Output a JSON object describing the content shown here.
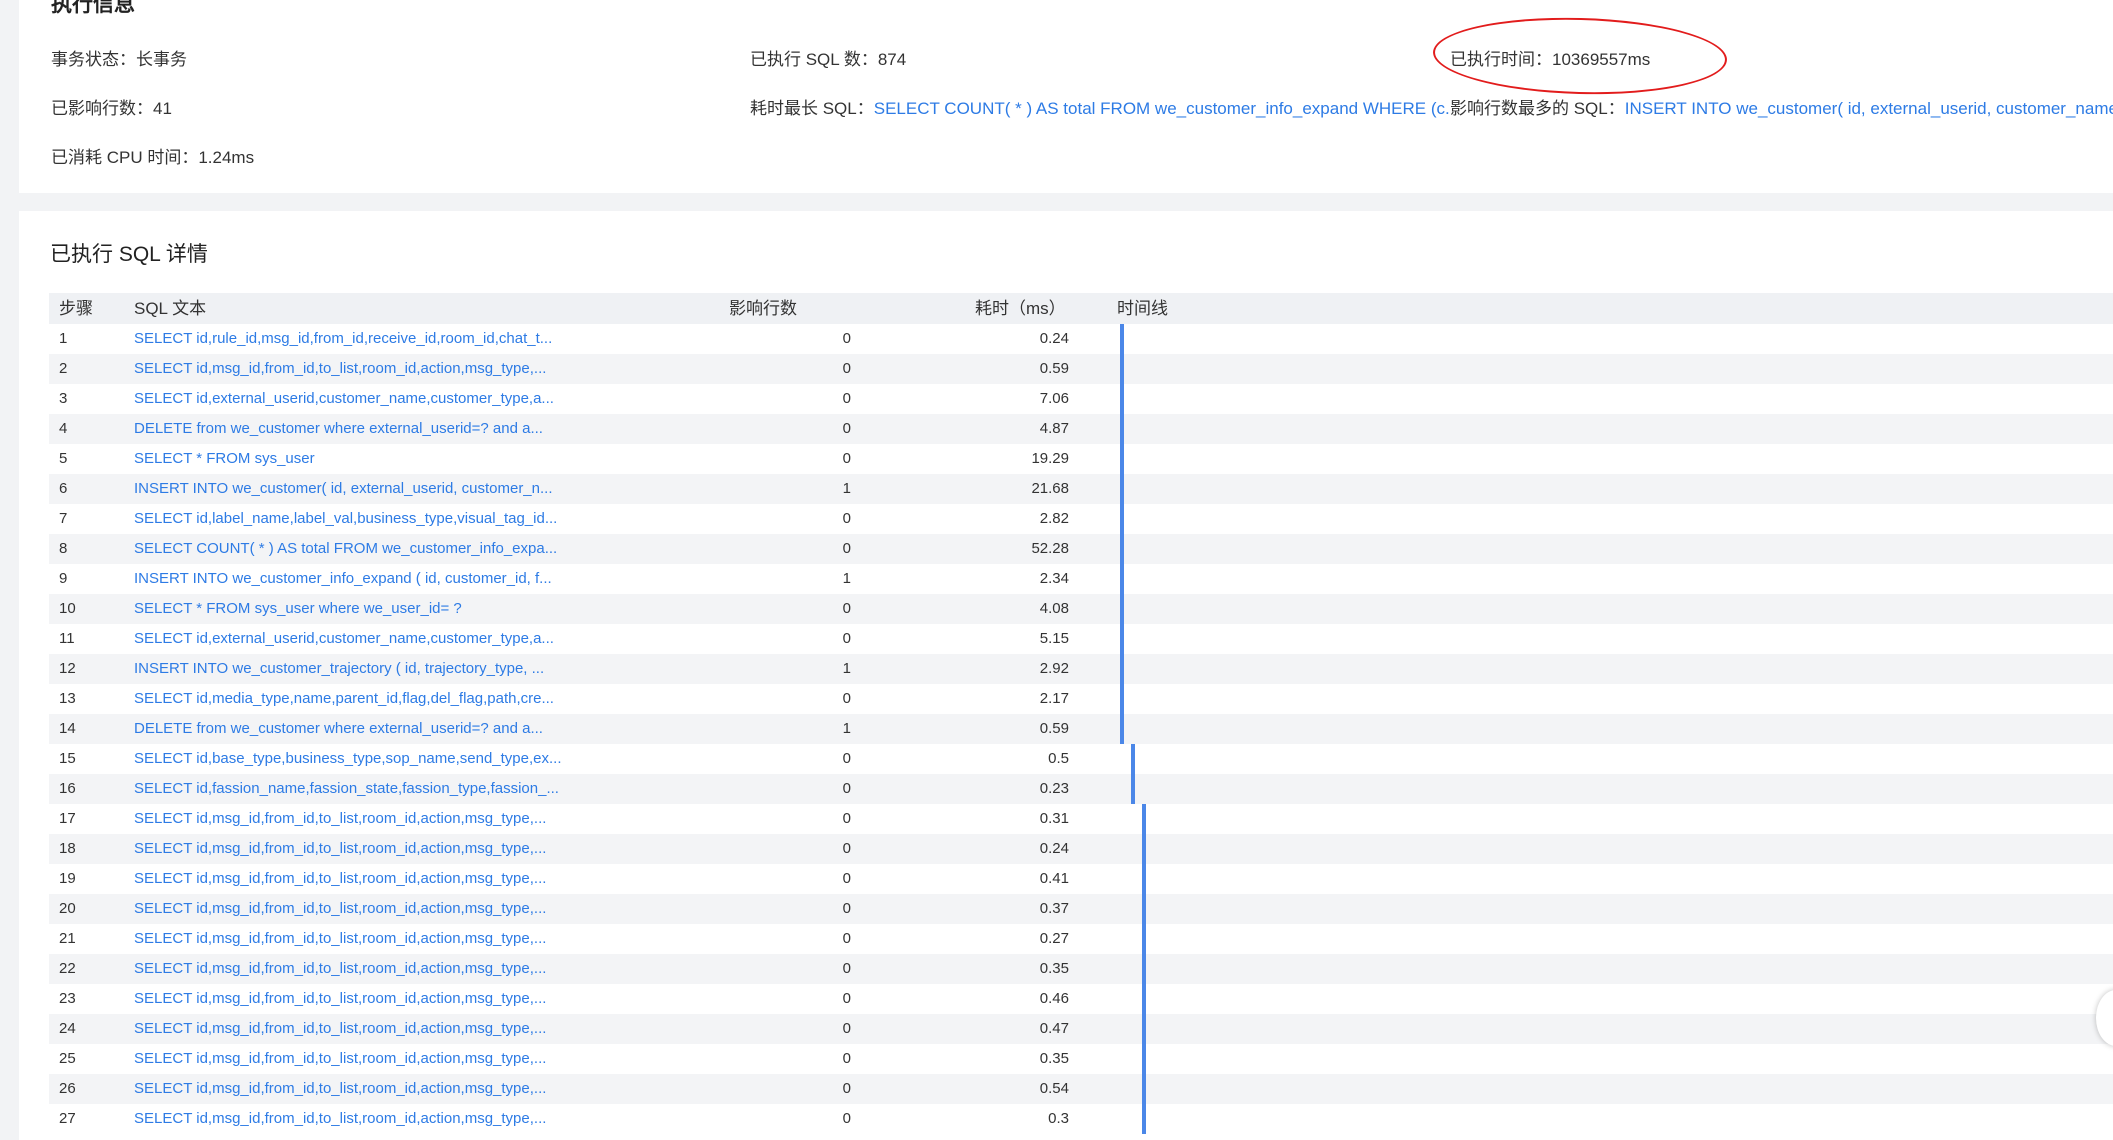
{
  "info": {
    "title": "执行信息",
    "transaction_status_label": "事务状态：",
    "transaction_status_value": "长事务",
    "executed_sql_count_label": "已执行 SQL 数：",
    "executed_sql_count_value": "874",
    "executed_time_label": "已执行时间：",
    "executed_time_value": "10369557ms",
    "affected_rows_label": "已影响行数：",
    "affected_rows_value": "41",
    "longest_sql_label": "耗时最长 SQL：",
    "longest_sql_value": "SELECT COUNT( * ) AS total FROM we_customer_info_expand WHERE (c...",
    "most_rows_sql_label": "影响行数最多的 SQL：",
    "most_rows_sql_value": "INSERT INTO we_customer( id, external_userid, customer_name,",
    "cpu_time_label": "已消耗 CPU 时间：",
    "cpu_time_value": "1.24ms"
  },
  "detail": {
    "title": "已执行 SQL 详情",
    "columns": [
      "步骤",
      "SQL 文本",
      "影响行数",
      "耗时（ms）",
      "时间线"
    ],
    "rows": [
      {
        "step": "1",
        "sql": "SELECT id,rule_id,msg_id,from_id,receive_id,room_id,chat_t...",
        "affected": "0",
        "time": "0.24"
      },
      {
        "step": "2",
        "sql": "SELECT id,msg_id,from_id,to_list,room_id,action,msg_type,...",
        "affected": "0",
        "time": "0.59"
      },
      {
        "step": "3",
        "sql": "SELECT id,external_userid,customer_name,customer_type,a...",
        "affected": "0",
        "time": "7.06"
      },
      {
        "step": "4",
        "sql": "DELETE from we_customer where external_userid=? and a...",
        "affected": "0",
        "time": "4.87"
      },
      {
        "step": "5",
        "sql": "SELECT * FROM sys_user",
        "affected": "0",
        "time": "19.29"
      },
      {
        "step": "6",
        "sql": "INSERT INTO we_customer( id, external_userid, customer_n...",
        "affected": "1",
        "time": "21.68"
      },
      {
        "step": "7",
        "sql": "SELECT id,label_name,label_val,business_type,visual_tag_id...",
        "affected": "0",
        "time": "2.82"
      },
      {
        "step": "8",
        "sql": "SELECT COUNT( * ) AS total FROM we_customer_info_expa...",
        "affected": "0",
        "time": "52.28"
      },
      {
        "step": "9",
        "sql": "INSERT INTO we_customer_info_expand ( id, customer_id, f...",
        "affected": "1",
        "time": "2.34"
      },
      {
        "step": "10",
        "sql": "SELECT * FROM sys_user where we_user_id= ?",
        "affected": "0",
        "time": "4.08"
      },
      {
        "step": "11",
        "sql": "SELECT id,external_userid,customer_name,customer_type,a...",
        "affected": "0",
        "time": "5.15"
      },
      {
        "step": "12",
        "sql": "INSERT INTO we_customer_trajectory ( id, trajectory_type, ...",
        "affected": "1",
        "time": "2.92"
      },
      {
        "step": "13",
        "sql": "SELECT id,media_type,name,parent_id,flag,del_flag,path,cre...",
        "affected": "0",
        "time": "2.17"
      },
      {
        "step": "14",
        "sql": "DELETE from we_customer where external_userid=? and a...",
        "affected": "1",
        "time": "0.59"
      },
      {
        "step": "15",
        "sql": "SELECT id,base_type,business_type,sop_name,send_type,ex...",
        "affected": "0",
        "time": "0.5"
      },
      {
        "step": "16",
        "sql": "SELECT id,fassion_name,fassion_state,fassion_type,fassion_...",
        "affected": "0",
        "time": "0.23"
      },
      {
        "step": "17",
        "sql": "SELECT id,msg_id,from_id,to_list,room_id,action,msg_type,...",
        "affected": "0",
        "time": "0.31"
      },
      {
        "step": "18",
        "sql": "SELECT id,msg_id,from_id,to_list,room_id,action,msg_type,...",
        "affected": "0",
        "time": "0.24"
      },
      {
        "step": "19",
        "sql": "SELECT id,msg_id,from_id,to_list,room_id,action,msg_type,...",
        "affected": "0",
        "time": "0.41"
      },
      {
        "step": "20",
        "sql": "SELECT id,msg_id,from_id,to_list,room_id,action,msg_type,...",
        "affected": "0",
        "time": "0.37"
      },
      {
        "step": "21",
        "sql": "SELECT id,msg_id,from_id,to_list,room_id,action,msg_type,...",
        "affected": "0",
        "time": "0.27"
      },
      {
        "step": "22",
        "sql": "SELECT id,msg_id,from_id,to_list,room_id,action,msg_type,...",
        "affected": "0",
        "time": "0.35"
      },
      {
        "step": "23",
        "sql": "SELECT id,msg_id,from_id,to_list,room_id,action,msg_type,...",
        "affected": "0",
        "time": "0.46"
      },
      {
        "step": "24",
        "sql": "SELECT id,msg_id,from_id,to_list,room_id,action,msg_type,...",
        "affected": "0",
        "time": "0.47"
      },
      {
        "step": "25",
        "sql": "SELECT id,msg_id,from_id,to_list,room_id,action,msg_type,...",
        "affected": "0",
        "time": "0.35"
      },
      {
        "step": "26",
        "sql": "SELECT id,msg_id,from_id,to_list,room_id,action,msg_type,...",
        "affected": "0",
        "time": "0.54"
      },
      {
        "step": "27",
        "sql": "SELECT id,msg_id,from_id,to_list,room_id,action,msg_type,...",
        "affected": "0",
        "time": "0.3"
      }
    ]
  },
  "colors": {
    "link": "#2d7be5",
    "timeline_bar": "#4b87e8",
    "annotation_circle": "#e21c1c",
    "header_bg": "#eff1f4"
  }
}
